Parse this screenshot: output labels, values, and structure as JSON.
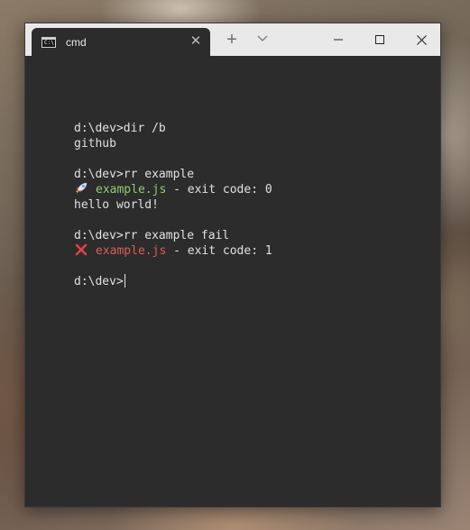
{
  "tab": {
    "title": "cmd",
    "icon": "cmd-prompt-icon",
    "icon_glyph": "C:\\."
  },
  "window_controls": {
    "new_tab_icon": "plus-icon",
    "dropdown_icon": "chevron-down-icon",
    "minimize_icon": "minimize-icon",
    "maximize_icon": "maximize-icon",
    "close_icon": "close-icon"
  },
  "colors": {
    "terminal_bg": "#2c2c2c",
    "success_text": "#8fcb6e",
    "error_text": "#e0595b"
  },
  "terminal": {
    "lines": [
      {
        "type": "text",
        "text": "d:\\dev>dir /b"
      },
      {
        "type": "text",
        "text": "github"
      },
      {
        "type": "blank"
      },
      {
        "type": "text",
        "text": "d:\\dev>rr example"
      },
      {
        "type": "status",
        "icon": "rocket-icon",
        "file": "example.js",
        "rest": " - exit code: 0",
        "status": "ok"
      },
      {
        "type": "text",
        "text": "hello world!"
      },
      {
        "type": "blank"
      },
      {
        "type": "text",
        "text": "d:\\dev>rr example fail"
      },
      {
        "type": "status",
        "icon": "red-x-icon",
        "file": "example.js",
        "rest": " - exit code: 1",
        "status": "err"
      },
      {
        "type": "blank"
      },
      {
        "type": "prompt",
        "text": "d:\\dev>"
      }
    ]
  }
}
